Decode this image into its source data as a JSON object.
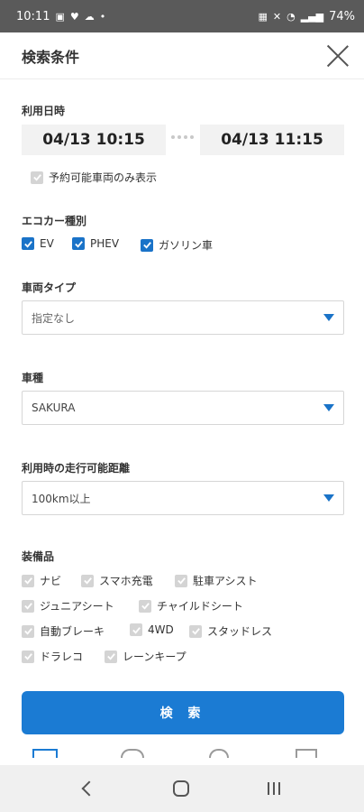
{
  "status_bar": {
    "time": "10:11",
    "battery": "74%",
    "left_icons": [
      "gallery-icon",
      "heart-icon",
      "cloud-icon",
      "dot-icon"
    ],
    "right_icons": [
      "nfc-icon",
      "mute-icon",
      "wifi-icon",
      "signal-icon"
    ]
  },
  "header": {
    "title": "検索条件"
  },
  "usage_datetime": {
    "label": "利用日時",
    "start": "04/13 10:15",
    "end": "04/13 11:15",
    "reservable_only": {
      "label": "予約可能車両のみ表示",
      "checked": false
    }
  },
  "eco_car_type": {
    "label": "エコカー種別",
    "options": [
      {
        "label": "EV",
        "checked": true
      },
      {
        "label": "PHEV",
        "checked": true
      },
      {
        "label": "ガソリン車",
        "checked": true
      }
    ]
  },
  "vehicle_type": {
    "label": "車両タイプ",
    "value": "指定なし"
  },
  "car_model": {
    "label": "車種",
    "value": "SAKURA"
  },
  "range": {
    "label": "利用時の走行可能距離",
    "value": "100km以上"
  },
  "equipment": {
    "label": "装備品",
    "items": [
      {
        "label": "ナビ",
        "checked": false
      },
      {
        "label": "スマホ充電",
        "checked": false
      },
      {
        "label": "駐車アシスト",
        "checked": false
      },
      {
        "label": "ジュニアシート",
        "checked": false
      },
      {
        "label": "チャイルドシート",
        "checked": false
      },
      {
        "label": "自動ブレーキ",
        "checked": false
      },
      {
        "label": "4WD",
        "checked": false
      },
      {
        "label": "スタッドレス",
        "checked": false
      },
      {
        "label": "ドラレコ",
        "checked": false
      },
      {
        "label": "レーンキープ",
        "checked": false
      }
    ]
  },
  "search_button": {
    "label": "検 索"
  },
  "colors": {
    "accent": "#1b7bd3",
    "checkbox_on": "#1a73c8",
    "checkbox_off": "#d4d4d4"
  }
}
